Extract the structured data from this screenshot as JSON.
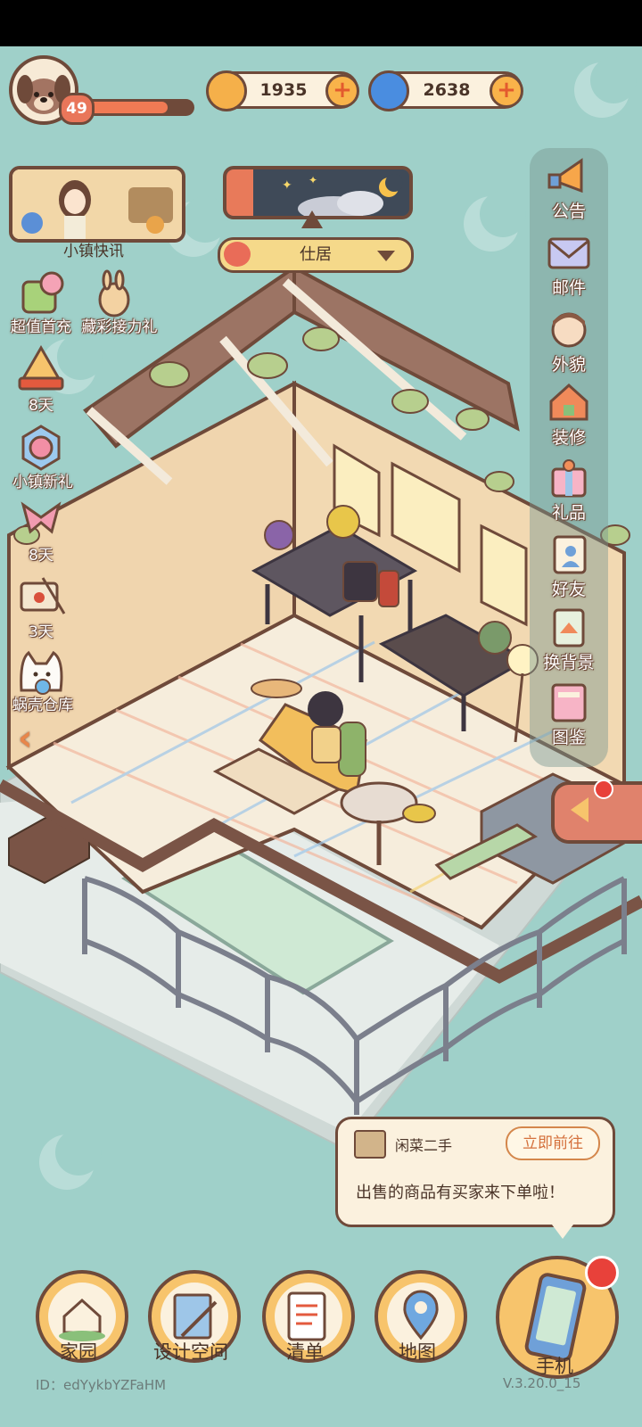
{
  "player": {
    "level": "49",
    "xp_fraction": 0.8
  },
  "currency": {
    "coins": "1935",
    "gems": "2638"
  },
  "left_menu": {
    "news": "小镇快讯",
    "items": [
      {
        "label": "超值首充"
      },
      {
        "label": "藏彩接力礼"
      },
      {
        "label": "8天"
      },
      {
        "label": "小镇新礼"
      },
      {
        "label": "8天"
      },
      {
        "label": "3天"
      },
      {
        "label": "蜗壳仓库"
      }
    ]
  },
  "location": {
    "name": "仕居"
  },
  "right_menu": {
    "items": [
      {
        "label": "公告",
        "icon": "megaphone-icon"
      },
      {
        "label": "邮件",
        "icon": "mail-icon"
      },
      {
        "label": "外貌",
        "icon": "avatar-icon"
      },
      {
        "label": "装修",
        "icon": "house-tools-icon"
      },
      {
        "label": "礼品",
        "icon": "gift-icon"
      },
      {
        "label": "好友",
        "icon": "friend-icon"
      },
      {
        "label": "换背景",
        "icon": "picture-icon"
      },
      {
        "label": "图鉴",
        "icon": "album-icon"
      }
    ]
  },
  "notification": {
    "title": "闲菜二手",
    "button": "立即前往",
    "message": "出售的商品有买家来下单啦！"
  },
  "bottom_nav": {
    "items": [
      {
        "label": "家园"
      },
      {
        "label": "设计空间"
      },
      {
        "label": "清单"
      },
      {
        "label": "地图"
      },
      {
        "label": "手机"
      }
    ]
  },
  "footer": {
    "id": "ID：edYykbYZFaHM",
    "version": "V.3.20.0_15"
  },
  "colors": {
    "background": "#9fd0c9",
    "outline": "#6f4a3a",
    "accent": "#f07a54"
  }
}
